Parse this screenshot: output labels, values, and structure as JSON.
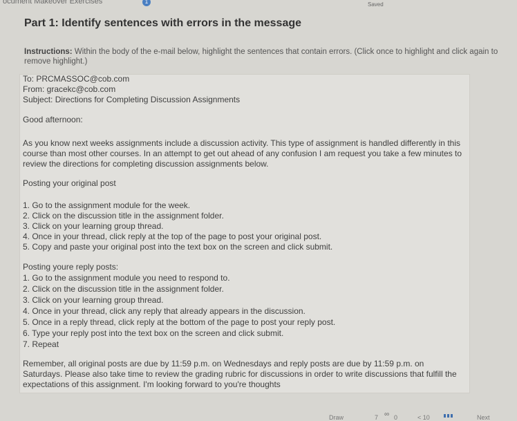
{
  "header": {
    "breadcrumb": "ocument Makeover Exercises",
    "badge": "1",
    "status": "Saved"
  },
  "part_title": "Part 1: Identify sentences with errors in the message",
  "instructions": {
    "label": "Instructions:",
    "text": " Within the body of the e-mail below, highlight the sentences that contain errors. (Click once to highlight and click again to remove highlight.)"
  },
  "email": {
    "to": "To: PRCMASSOC@cob.com",
    "from": "From: gracekc@cob.com",
    "subject": "Subject: Directions for Completing Discussion Assignments",
    "greeting": "Good afternoon:",
    "intro": "As you know next weeks assignments include a discussion activity. This type of assignment is handled differently in this course than most other courses. In an attempt to get out ahead of any confusion I am request you take a few minutes to review the directions for completing discussion assignments below.",
    "original_heading": "Posting your original post",
    "original_steps": [
      "1. Go to the assignment module for the week.",
      "2. Click on the discussion title in the assignment folder.",
      "3. Click on your learning group thread.",
      "4. Once in your thread, click reply at the top of the page to post your original post.",
      "5. Copy and paste your original post into the text box on the screen and click submit."
    ],
    "reply_heading": "Posting youre reply posts:",
    "reply_steps": [
      "1. Go to the assignment module you need to respond to.",
      "2. Click on the discussion title in the assignment folder.",
      "3. Click on your learning group thread.",
      "4. Once in your thread, click any reply that already appears in the discussion.",
      "5. Once in a reply thread, click reply at the bottom of the page to post your reply post.",
      "6. Type your reply post into the text box on the screen and click submit.",
      "7. Repeat"
    ],
    "closing": "Remember, all original posts are due by 11:59 p.m. on Wednesdays and reply posts are due by 11:59 p.m. on Saturdays. Please also take time to review the grading rubric for discussions in order to write discussions that fulfill the expectations of this assignment. I'm looking forward to you're thoughts"
  },
  "toolbar": {
    "draw": "Draw",
    "num1": "7",
    "num2": "0",
    "zoom": "< 10",
    "next": "Next",
    "link_icon": "link-icon",
    "grid_icon": "grid-icon"
  }
}
